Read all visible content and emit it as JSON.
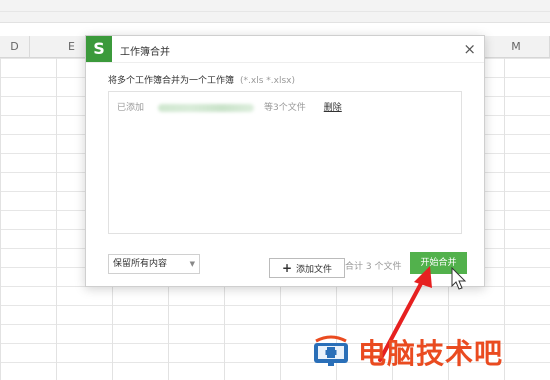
{
  "columns": [
    "D",
    "E",
    "M"
  ],
  "dialog": {
    "logo_letter": "S",
    "title": "工作簿合并",
    "close_glyph": "×",
    "description": "将多个工作簿合并为一个工作簿",
    "extensions": "(*.xls *.xlsx)",
    "file_row": {
      "added_label": "已添加",
      "count_text": "等3个文件",
      "delete_label": "删除"
    },
    "add_file_label": "添加文件",
    "retain_option": "保留所有内容",
    "total_text": "合计 3 个文件",
    "merge_button": "开始合并"
  },
  "watermark": {
    "text": "电脑技术吧"
  },
  "colors": {
    "accent_green": "#52b14c",
    "logo_green": "#3b9a3b",
    "arrow_red": "#e62020",
    "watermark_orange": "#ea4b20"
  }
}
